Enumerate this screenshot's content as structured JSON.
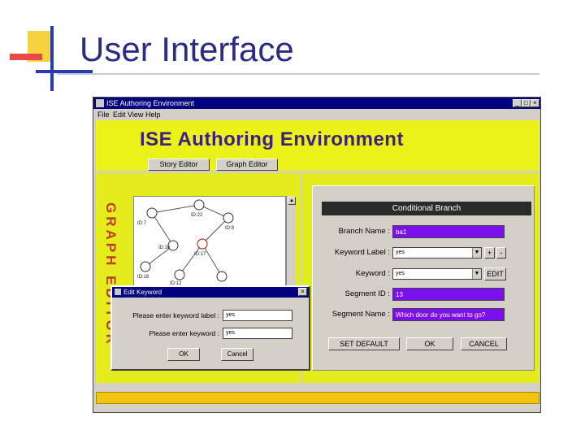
{
  "slide": {
    "title": "User Interface"
  },
  "window": {
    "title": "ISE Authoring Environment",
    "menu": [
      "File",
      "Edit",
      "View",
      "Help"
    ],
    "heading": "ISE  Authoring  Environment",
    "tabs": {
      "story_editor": "Story Editor",
      "graph_editor": "Graph Editor"
    },
    "left_panel": {
      "vertical_label": "GRAPH EDITOR"
    },
    "graph": {
      "nodes": [
        "ID:7",
        "ID:22",
        "ID:9",
        "ID:16",
        "ID:17",
        "ID:18",
        "ID:12"
      ]
    },
    "conditional_branch": {
      "title": "Conditional Branch",
      "branch_name_label": "Branch Name :",
      "branch_name_value": "ba1",
      "keyword_label_label": "Keyword Label :",
      "keyword_label_value": "yes",
      "plus": "+",
      "minus": "-",
      "keyword_label": "Keyword :",
      "keyword_value": "yes",
      "edit": "EDIT",
      "segment_id_label": "Segment ID :",
      "segment_id_value": "13",
      "segment_name_label": "Segment Name :",
      "segment_name_value": "Which door do you want to go?",
      "set_default": "SET DEFAULT",
      "ok": "OK",
      "cancel": "CANCEL"
    }
  },
  "dialog": {
    "title": "Edit Keyword",
    "label_prompt": "Please enter keyword label :",
    "label_value": "yes",
    "keyword_prompt": "Please enter keyword :",
    "keyword_value": "yes",
    "ok": "OK",
    "cancel": "Cancel"
  },
  "colors": {
    "title_text": "#2a2a88",
    "panel_yellow": "#e4ec1c",
    "heading_purple": "#3e1e86",
    "field_purple": "#7b10ee",
    "vertical_label_red": "#c03a2c",
    "status_gold": "#f1c40f"
  }
}
